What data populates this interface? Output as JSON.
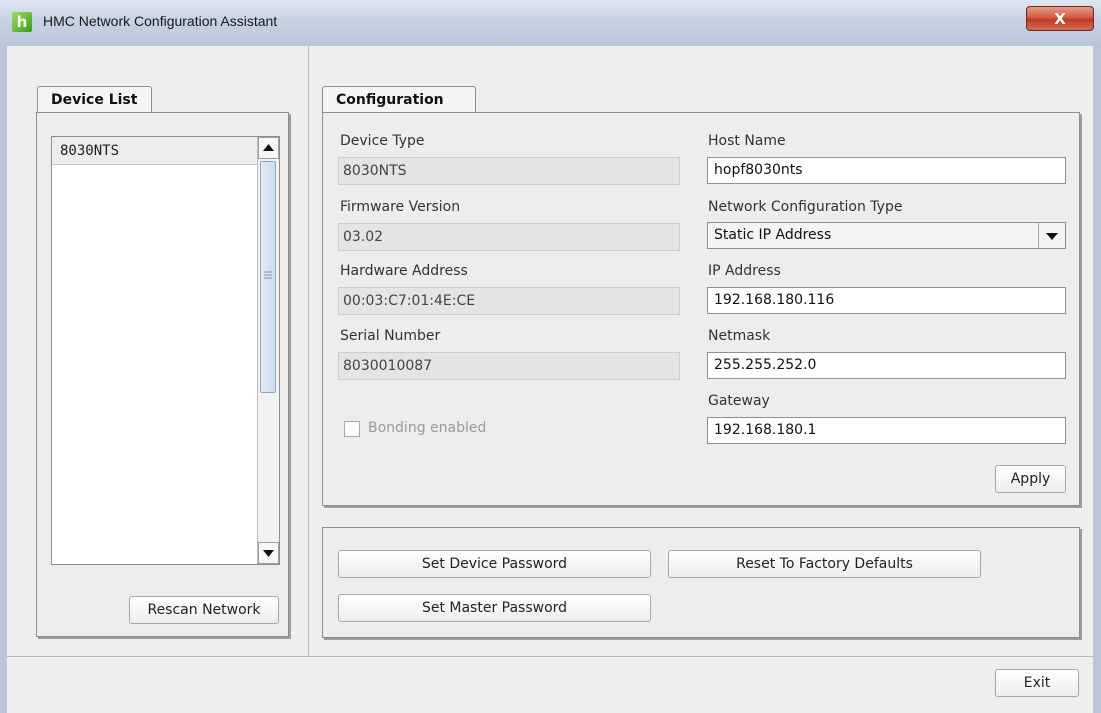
{
  "window": {
    "title": "HMC Network Configuration Assistant",
    "close_symbol": "X",
    "app_icon_letter": "h"
  },
  "device_list": {
    "tab_label": "Device List",
    "items": [
      "8030NTS"
    ],
    "rescan_label": "Rescan Network"
  },
  "configuration": {
    "tab_label": "Configuration",
    "device_type_label": "Device Type",
    "device_type_value": "8030NTS",
    "firmware_version_label": "Firmware Version",
    "firmware_version_value": "03.02",
    "hardware_address_label": "Hardware Address",
    "hardware_address_value": "00:03:C7:01:4E:CE",
    "serial_number_label": "Serial Number",
    "serial_number_value": "8030010087",
    "bonding_label": "Bonding enabled",
    "bonding_checked": false,
    "host_name_label": "Host Name",
    "host_name_value": "hopf8030nts",
    "network_type_label": "Network Configuration Type",
    "network_type_value": "Static IP Address",
    "ip_address_label": "IP Address",
    "ip_address_value": "192.168.180.116",
    "netmask_label": "Netmask",
    "netmask_value": "255.255.252.0",
    "gateway_label": "Gateway",
    "gateway_value": "192.168.180.1",
    "apply_label": "Apply"
  },
  "actions": {
    "set_device_password": "Set Device Password",
    "reset_factory_defaults": "Reset To Factory Defaults",
    "set_master_password": "Set Master Password"
  },
  "footer": {
    "exit_label": "Exit"
  },
  "colors": {
    "titlebar": "#c6d3e1",
    "close_button": "#c9432e",
    "app_icon": "#5cb82a",
    "scroll_thumb": "#c9d9ec"
  },
  "icons": [
    "app-logo-icon",
    "close-icon",
    "arrow-up-icon",
    "arrow-down-icon",
    "grip-icon",
    "chevron-down-icon"
  ]
}
